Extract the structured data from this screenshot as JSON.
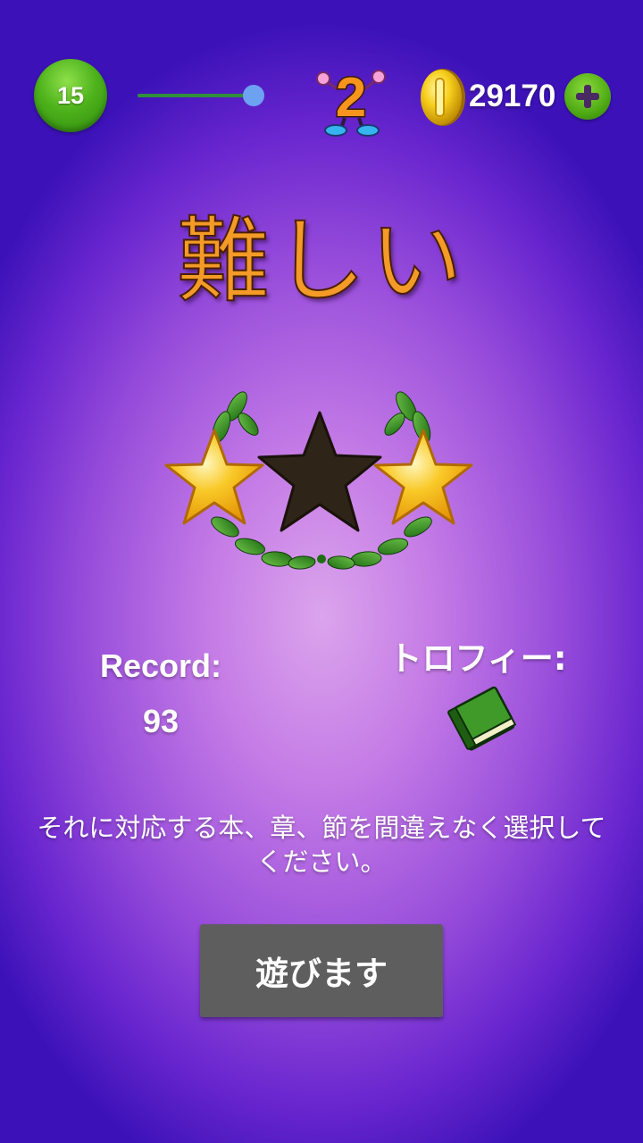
{
  "header": {
    "level": "15",
    "progress_fraction": 1.0,
    "mascot_number": "2",
    "coins": "29170"
  },
  "title": "難しい",
  "stars": {
    "earned": 2,
    "total": 3,
    "states": [
      "gold",
      "dark",
      "gold"
    ]
  },
  "record": {
    "label": "Record:",
    "value": "93"
  },
  "trophy": {
    "label": "トロフィー:",
    "icon": "green-book-icon"
  },
  "instructions": "それに対応する本、章、節を間違えなく選択してください。",
  "play_button": {
    "label": "遊びます"
  },
  "colors": {
    "background_center": "#dba4ec",
    "background_edge": "#3c12b8",
    "title_fill": "#f39a27",
    "level_badge": "#4db21b",
    "progress_thumb": "#6da2f2",
    "button_bg": "#5e5e5e"
  }
}
